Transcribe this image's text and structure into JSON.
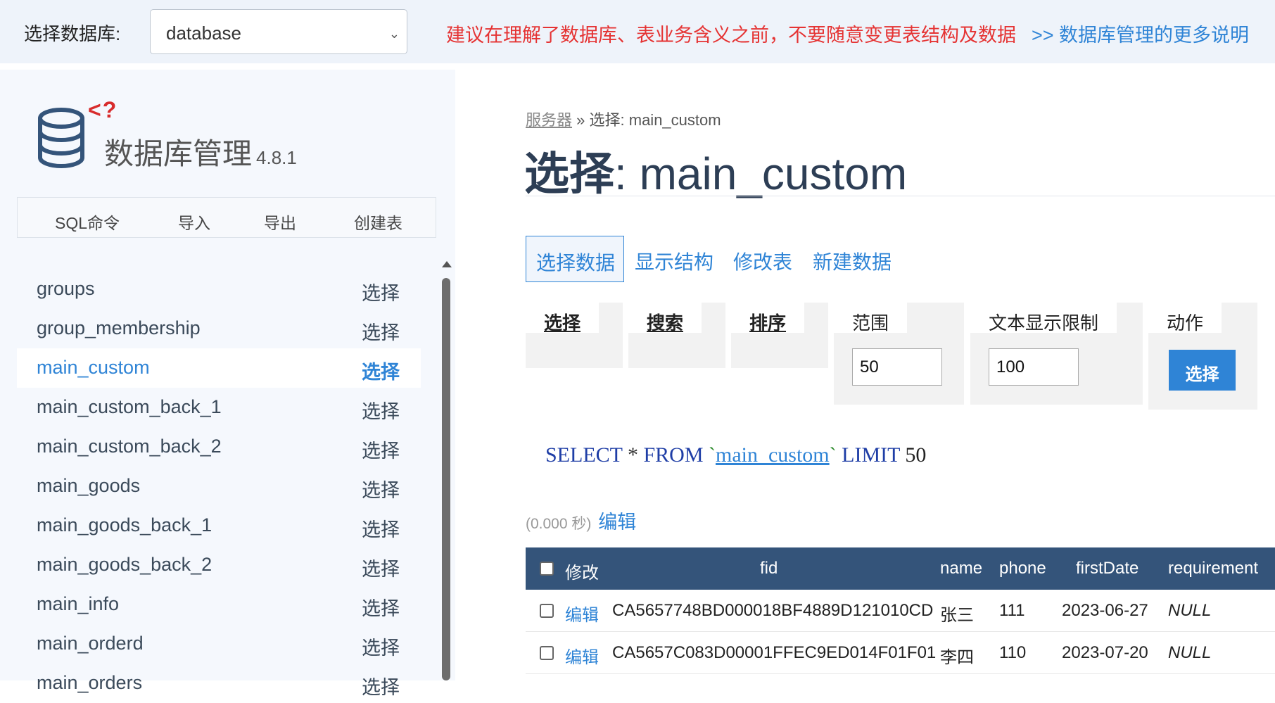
{
  "topbar": {
    "db_label": "选择数据库:",
    "db_value": "database",
    "warning": "建议在理解了数据库、表业务含义之前，不要随意变更表结构及数据",
    "more_link": ">> 数据库管理的更多说明"
  },
  "sidebar": {
    "logo_mark": "<?",
    "title": "数据库管理",
    "version": "4.8.1",
    "quick_links": [
      "SQL命令",
      "导入",
      "导出",
      "创建表"
    ],
    "select_label": "选择",
    "tables": [
      {
        "name": "groups",
        "active": false
      },
      {
        "name": "group_membership",
        "active": false
      },
      {
        "name": "main_custom",
        "active": true
      },
      {
        "name": "main_custom_back_1",
        "active": false
      },
      {
        "name": "main_custom_back_2",
        "active": false
      },
      {
        "name": "main_goods",
        "active": false
      },
      {
        "name": "main_goods_back_1",
        "active": false
      },
      {
        "name": "main_goods_back_2",
        "active": false
      },
      {
        "name": "main_info",
        "active": false
      },
      {
        "name": "main_orderd",
        "active": false
      },
      {
        "name": "main_orders",
        "active": false
      }
    ]
  },
  "main": {
    "breadcrumb_root": "服务器",
    "breadcrumb_sep": "»",
    "breadcrumb_current": "选择: main_custom",
    "title_prefix": "选择",
    "title_rest": ": main_custom",
    "tabs": [
      "选择数据",
      "显示结构",
      "修改表",
      "新建数据"
    ],
    "fieldsets": {
      "select": "选择",
      "search": "搜索",
      "sort": "排序",
      "limit_legend": "范围",
      "limit_value": "50",
      "text_limit_legend": "文本显示限制",
      "text_limit_value": "100",
      "action_legend": "动作",
      "action_button": "选择"
    },
    "sql": {
      "select": "SELECT",
      "star": "*",
      "from": "FROM",
      "table": "main_custom",
      "limit": "LIMIT",
      "limit_value": "50"
    },
    "timing": "(0.000 秒)",
    "timing_edit": "编辑",
    "results": {
      "columns": [
        "修改",
        "fid",
        "name",
        "phone",
        "firstDate",
        "requirement"
      ],
      "edit_label": "编辑",
      "rows": [
        {
          "fid": "CA5657748BD000018BF4889D121010CD",
          "name": "张三",
          "phone": "111",
          "firstDate": "2023-06-27",
          "requirement": "NULL"
        },
        {
          "fid": "CA5657C083D00001FFEC9ED014F01F01",
          "name": "李四",
          "phone": "110",
          "firstDate": "2023-07-20",
          "requirement": "NULL"
        }
      ]
    }
  },
  "colors": {
    "accent": "#2f84d6",
    "warning": "#e53333",
    "table_header": "#34547a",
    "sidebar_bg": "#f5f8fd",
    "topbar_bg": "#eef3fa"
  }
}
